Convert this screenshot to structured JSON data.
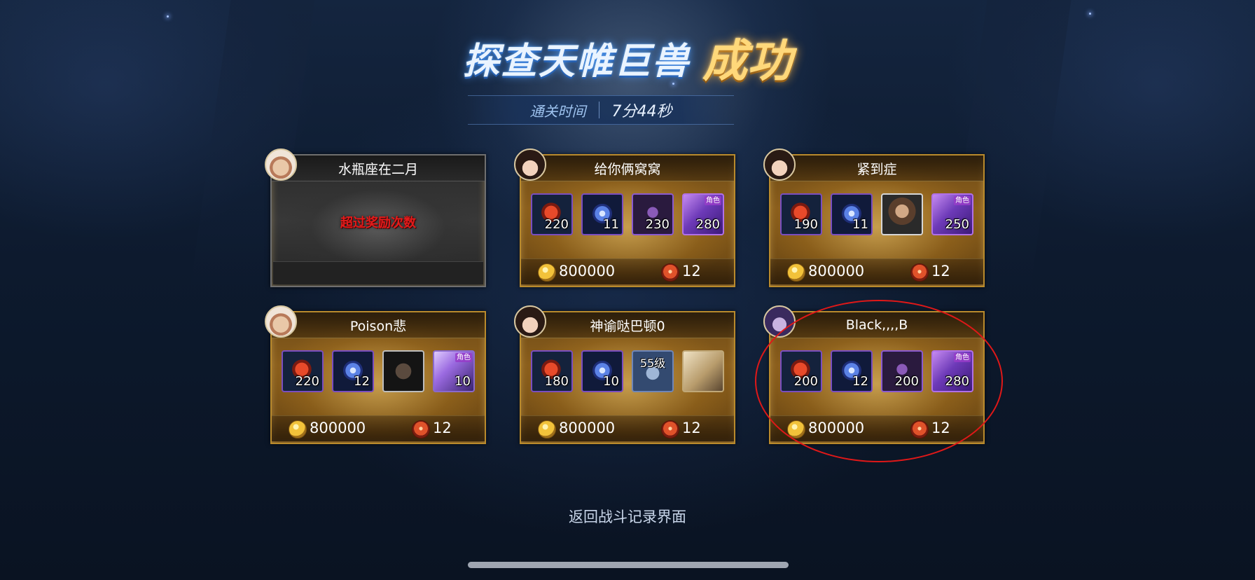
{
  "title": {
    "main": "探查天帷巨兽",
    "result": "成功"
  },
  "clear_time": {
    "label": "通关时间",
    "value": "7分44秒"
  },
  "players": [
    {
      "name": "水瓶座在二月",
      "status": "gray",
      "message": "超过奖励次数",
      "items": [],
      "gold": "",
      "tokens": ""
    },
    {
      "name": "给你俩窝窝",
      "status": "gold",
      "items": [
        {
          "icon": "red-crystal-icon",
          "count": "220"
        },
        {
          "icon": "blue-orb-icon",
          "count": "11"
        },
        {
          "icon": "hero-shard-icon",
          "count": "230"
        },
        {
          "icon": "purple-orb-icon",
          "tag": "角色",
          "count": "280"
        }
      ],
      "gold": "800000",
      "tokens": "12"
    },
    {
      "name": "紧到症",
      "status": "gold",
      "items": [
        {
          "icon": "red-crystal-icon",
          "count": "190"
        },
        {
          "icon": "blue-orb-icon",
          "count": "11"
        },
        {
          "icon": "character-portrait-icon",
          "count": ""
        },
        {
          "icon": "purple-orb-icon",
          "tag": "角色",
          "count": "250"
        }
      ],
      "gold": "800000",
      "tokens": "12"
    },
    {
      "name": "Poison悲",
      "status": "gold",
      "items": [
        {
          "icon": "red-crystal-icon",
          "count": "220"
        },
        {
          "icon": "blue-orb-icon",
          "count": "12"
        },
        {
          "icon": "dark-character-icon",
          "count": ""
        },
        {
          "icon": "purple-gem-icon",
          "tag": "角色",
          "count": "10"
        }
      ],
      "gold": "800000",
      "tokens": "12"
    },
    {
      "name": "神谕哒巴顿0",
      "status": "gold",
      "items": [
        {
          "icon": "red-crystal-icon",
          "count": "180"
        },
        {
          "icon": "blue-orb-icon",
          "count": "10"
        },
        {
          "icon": "armor-icon",
          "level": "55级",
          "count": ""
        },
        {
          "icon": "book-icon",
          "count": ""
        }
      ],
      "gold": "800000",
      "tokens": "12"
    },
    {
      "name": "Black,,,,B",
      "status": "gold",
      "items": [
        {
          "icon": "red-crystal-icon",
          "count": "200"
        },
        {
          "icon": "blue-orb-icon",
          "count": "12"
        },
        {
          "icon": "hero-shard-icon",
          "count": "200"
        },
        {
          "icon": "purple-orb-icon",
          "tag": "角色",
          "count": "280"
        }
      ],
      "gold": "800000",
      "tokens": "12"
    }
  ],
  "return_label": "返回战斗记录界面",
  "colors": {
    "highlight": "#e01818",
    "gold_border": "#b98a2c",
    "warning_text": "#e21b1b"
  }
}
